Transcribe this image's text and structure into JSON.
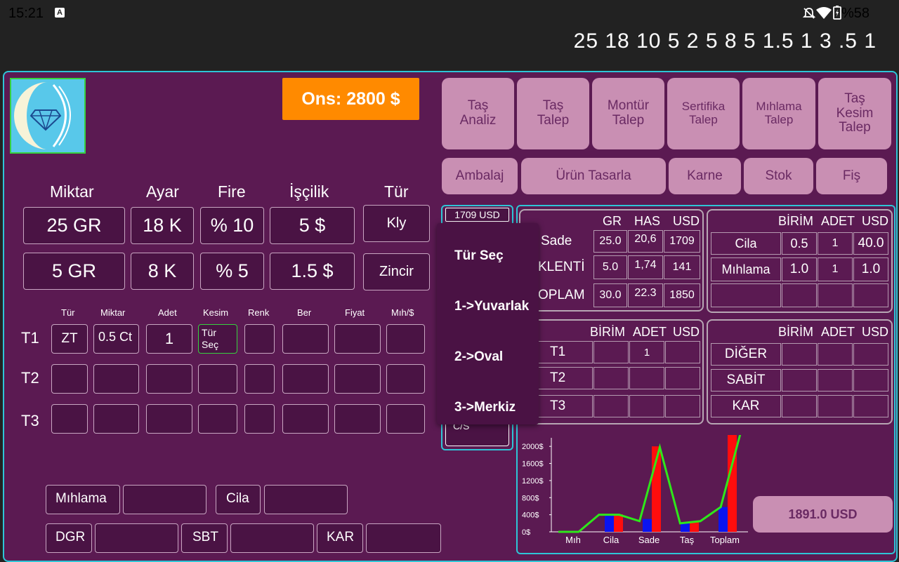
{
  "status": {
    "time": "15:21",
    "a_badge": "A",
    "battery": "%58"
  },
  "ticker": "25 18 10 5 2 5 8 5 1.5 1 3 .5 1",
  "ons": "Ons: 2800 $",
  "top_buttons": [
    "Taş\nAnaliz",
    "Taş\nTalep",
    "Montür\nTalep",
    "Sertifika\nTalep",
    "Mıhlama\nTalep",
    "Taş\nKesim\nTalep"
  ],
  "second_buttons": [
    "Ambalaj",
    "Ürün Tasarla",
    "Karne",
    "Stok",
    "Fiş"
  ],
  "inputs": {
    "headers": [
      "Miktar",
      "Ayar",
      "Fire",
      "İşçilik",
      "Tür"
    ],
    "row1": [
      "25 GR",
      "18 K",
      "% 10",
      "5 $",
      "Kly"
    ],
    "row2": [
      "5 GR",
      "8 K",
      "% 5",
      "1.5 $",
      "Zincir"
    ]
  },
  "stones": {
    "headers": [
      "Tür",
      "Miktar",
      "Adet",
      "Kesim",
      "Renk",
      "Ber",
      "Fiyat",
      "Mıh/$"
    ],
    "rows": [
      "T1",
      "T2",
      "T3"
    ],
    "t1": [
      "ZT",
      "0.5 Ct",
      "1",
      "Tür\nSeç"
    ]
  },
  "bottom": [
    "Mıhlama",
    "Cila",
    "DGR",
    "SBT",
    "KAR"
  ],
  "usd_box": {
    "top": "1709 USD",
    "bottom": "C/S"
  },
  "dropdown": {
    "title": "Tür Seç",
    "items": [
      "1->Yuvarlak",
      "2->Oval",
      "3->Merkiz"
    ]
  },
  "table1": {
    "headers": [
      "GR",
      "HAS",
      "USD"
    ],
    "rows": [
      {
        "label": "Sade",
        "gr": "25.0",
        "has": "20,6",
        "usd": "1709"
      },
      {
        "label": "KLENTİ",
        "gr": "5.0",
        "has": "1,74",
        "usd": "141"
      },
      {
        "label": "OPLAM",
        "gr": "30.0",
        "has": "22.3",
        "usd": "1850"
      }
    ]
  },
  "table2": {
    "headers": [
      "BİRİM",
      "ADET",
      "USD"
    ],
    "rows": [
      {
        "label": "Cila",
        "b": "0.5",
        "a": "1",
        "u": "40.0"
      },
      {
        "label": "Mıhlama",
        "b": "1.0",
        "a": "1",
        "u": "1.0"
      },
      {
        "label": "",
        "b": "",
        "a": "",
        "u": ""
      }
    ]
  },
  "table3": {
    "headers": [
      "BİRİM",
      "ADET",
      "USD"
    ],
    "rows": [
      {
        "label": "T1",
        "b": "",
        "a": "1",
        "u": ""
      },
      {
        "label": "T2",
        "b": "",
        "a": "",
        "u": ""
      },
      {
        "label": "T3",
        "b": "",
        "a": "",
        "u": ""
      }
    ]
  },
  "table4": {
    "headers": [
      "BİRİM",
      "ADET",
      "USD"
    ],
    "rows": [
      {
        "label": "DİĞER"
      },
      {
        "label": "SABİT"
      },
      {
        "label": "KAR"
      }
    ]
  },
  "chart_data": {
    "type": "bar",
    "categories": [
      "Mıh",
      "Cila",
      "Sade",
      "Taş",
      "Toplam"
    ],
    "y_tick_labels": [
      "2000$",
      "1600$",
      "1200$",
      "800$",
      "400$",
      "0$"
    ],
    "ylim": [
      0,
      2200
    ],
    "series": [
      {
        "color": "#0a14f0",
        "values": [
          0,
          400,
          300,
          220,
          580
        ]
      },
      {
        "color": "#ff0d0d",
        "values": [
          0,
          410,
          2000,
          240,
          2350
        ]
      }
    ],
    "line": {
      "color": "#2ee81a",
      "values": [
        0,
        0,
        400,
        400,
        250,
        1980,
        200,
        250,
        580,
        2350
      ]
    }
  },
  "total": "1891.0 USD"
}
